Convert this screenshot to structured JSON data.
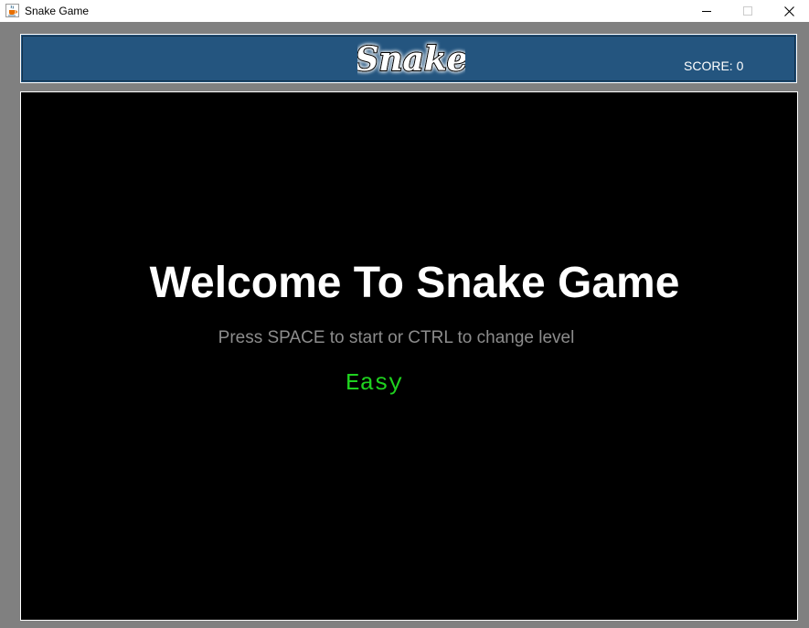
{
  "window": {
    "title": "Snake Game",
    "icon": "java-cup-icon",
    "controls": {
      "minimize": "minimize-icon",
      "maximize": "maximize-icon",
      "close": "close-icon"
    }
  },
  "header": {
    "logo_text": "Snake",
    "score_text": "SCORE: 0"
  },
  "game": {
    "welcome_title": "Welcome To Snake Game",
    "instructions": "Press SPACE to start or CTRL to change level",
    "level": "Easy"
  },
  "colors": {
    "header_background": "#24557f",
    "board_background": "#000000",
    "window_background": "#808080",
    "level_text": "#1fd21f",
    "instructions_text": "#8c8c8c"
  }
}
